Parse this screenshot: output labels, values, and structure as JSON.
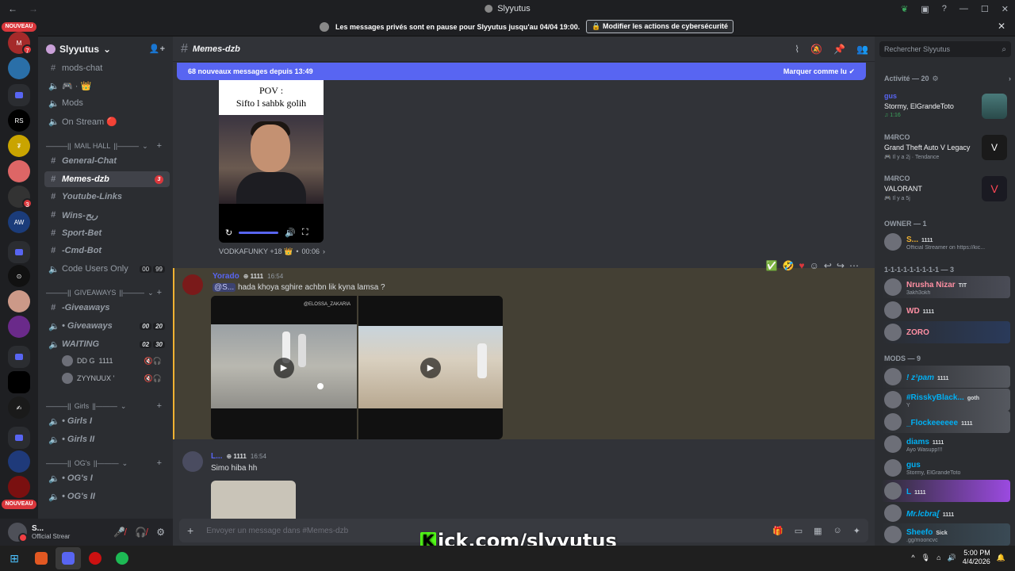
{
  "window": {
    "title": "Slyyutus"
  },
  "notice": {
    "text": "Les messages privés sont en pause pour Slyyutus jusqu'au 04/04 19:00.",
    "button": "Modifier les actions de cybersécurité"
  },
  "rail": {
    "new_badge": "NOUVEAU",
    "new_badge_2": "NOUVEAU",
    "badges": [
      "7",
      "3"
    ]
  },
  "guild": {
    "name": "Slyyutus"
  },
  "channels": {
    "items": [
      {
        "label": "mods-chat"
      },
      {
        "label": "🎮 · 👑"
      },
      {
        "label": "Mods"
      },
      {
        "label": "On Stream 🔴"
      },
      {
        "label": "General-Chat"
      },
      {
        "label": "Memes-dzb",
        "badge": "3"
      },
      {
        "label": "Youtube-Links"
      },
      {
        "label": "Wins-ربح"
      },
      {
        "label": "Sport-Bet"
      },
      {
        "label": "-Cmd-Bot"
      },
      {
        "label": "Code Users Only",
        "c1": "00",
        "c2": "99"
      },
      {
        "label": "-Giveaways"
      },
      {
        "label": "• Giveaways",
        "c1": "00",
        "c2": "20"
      },
      {
        "label": "WAITING",
        "c1": "02",
        "c2": "30"
      },
      {
        "label": "• Girls I"
      },
      {
        "label": "• Girls II"
      },
      {
        "label": "• OG's I"
      },
      {
        "label": "• OG's II"
      }
    ],
    "categories": [
      "MAIL HALL",
      "GIVEAWAYS",
      "Girls",
      "OG's"
    ],
    "voice_users": [
      {
        "name": "DD G",
        "tag": "1111"
      },
      {
        "name": "ZYYNUUX '"
      }
    ]
  },
  "user_panel": {
    "name": "S...",
    "status": "Official Strear"
  },
  "channel_header": {
    "name": "Memes-dzb"
  },
  "new_bar": {
    "text": "68 nouveaux messages depuis 13:49",
    "mark": "Marquer comme lu"
  },
  "messages": {
    "video1": {
      "pov_line1": "POV :",
      "pov_line2": "Sifto l sahbk golih"
    },
    "react_meta": {
      "author": "VODKAFUNKY +18 👑",
      "duration": "00:06"
    },
    "m1": {
      "author": "Yorado",
      "tag": "1111",
      "time": "16:54",
      "mention": "@S...",
      "text": "hada khoya sghire achbn lik kyna lamsa ?",
      "video_label": "@ELOSSA_ZAKARIA"
    },
    "m2": {
      "author": "L...",
      "tag": "1111",
      "time": "16:54",
      "text": "Simo hiba hh"
    }
  },
  "composer": {
    "placeholder": "Envoyer un message dans #Memes-dzb"
  },
  "members": {
    "search_placeholder": "Rechercher Slyyutus",
    "activity_header": "Activité — 20",
    "activities": [
      {
        "user": "gus",
        "line": "Stormy, ElGrandeToto",
        "meta": "1:16"
      },
      {
        "user": "M4RCO",
        "line": "Grand Theft Auto V Legacy",
        "meta": "Il y a 2j · Tendance"
      },
      {
        "user": "M4RCO",
        "line": "VALORANT",
        "meta": "Il y a 5j"
      }
    ],
    "owner_header": "OWNER — 1",
    "owner": {
      "name": "S...",
      "tag": "1111",
      "sub": "Official Streamer on https://kic..."
    },
    "role_header": "1-1-1-1-1-1-1-1-1 — 3",
    "role_members": [
      {
        "name": "Nrusha Nizar",
        "tag": "TIT",
        "sub": "3akh3okh"
      },
      {
        "name": "WD",
        "tag": "1111"
      },
      {
        "name": "ZORO"
      }
    ],
    "mods_header": "MODS — 9",
    "mods": [
      {
        "name": "! z¹pam",
        "tag": "1111"
      },
      {
        "name": "#RisskyBlack...",
        "tag": "goth",
        "sub": "Y"
      },
      {
        "name": "_Flockeeeeee",
        "tag": "1111"
      },
      {
        "name": "diams",
        "tag": "1111",
        "sub": "Ayo Wasupp!!!"
      },
      {
        "name": "gus",
        "sub": "Stormy, ElGrandeToto"
      },
      {
        "name": "L",
        "tag": "1111"
      },
      {
        "name": "Mr.lcbra[",
        "tag": "1111"
      },
      {
        "name": "Sheefo",
        "tag": "Sick",
        "sub": ".gg/mooncvc"
      }
    ]
  },
  "overlay": {
    "kick": "ick.com/slyyutus",
    "kick_letter": "K"
  },
  "taskbar": {
    "time": "5:00 PM",
    "date": "4/4/2026"
  },
  "colors": {
    "accent": "#5865f2",
    "highlight": "#f0b232",
    "danger": "#da373c",
    "kick": "#53fc18"
  }
}
